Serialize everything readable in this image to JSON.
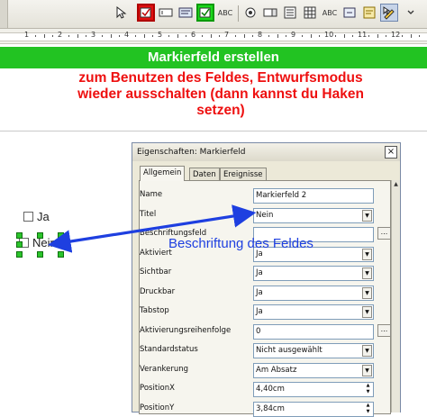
{
  "toolbar": {
    "buttons": [
      {
        "name": "checkbox-tool-button",
        "icon": "checkbox-icon",
        "state": "highlighted-red"
      },
      {
        "name": "textbox-tool-button",
        "icon": "text-field-icon",
        "state": "normal"
      },
      {
        "name": "label-tool-button",
        "icon": "label-icon",
        "state": "normal"
      },
      {
        "name": "checkbox-selected-button",
        "icon": "checkbox-checked-icon",
        "state": "highlighted-green"
      },
      {
        "name": "abc-button",
        "label": "ABC",
        "icon": "abc-icon",
        "state": "normal"
      },
      {
        "name": "radio-button-tool",
        "icon": "radio-icon",
        "state": "normal"
      },
      {
        "name": "grid-button",
        "icon": "grid-icon",
        "state": "normal"
      },
      {
        "name": "abc-button-2",
        "label": "ABC",
        "icon": "abc-icon",
        "state": "normal"
      },
      {
        "name": "form-button",
        "icon": "form-icon",
        "state": "normal"
      },
      {
        "name": "design-mode-button",
        "icon": "design-mode-icon",
        "state": "active"
      }
    ]
  },
  "ruler": {
    "numbers": [
      "1",
      "2",
      "3",
      "4",
      "5",
      "6",
      "7",
      "8",
      "9",
      "10",
      "11",
      "12"
    ]
  },
  "banner": {
    "text": "Markierfeld erstellen"
  },
  "instruction": {
    "line1": "zum Benutzen des Feldes, Entwurfsmodus",
    "line2": "wieder ausschalten (dann kannst du Haken",
    "line3": "setzen)"
  },
  "document": {
    "checkbox_ja": "Ja",
    "checkbox_nein": "Nein"
  },
  "annotation": {
    "label": "Beschriftung des Feldes"
  },
  "dialog": {
    "title": "Eigenschaften: Markierfeld",
    "close_glyph": "×",
    "tabs": [
      "Allgemein",
      "Daten",
      "Ereignisse"
    ],
    "selected_tab": "Allgemein",
    "properties": [
      {
        "label": "Name",
        "value": "Markierfeld 2",
        "control": "text"
      },
      {
        "label": "Titel",
        "value": "Nein",
        "control": "dropdown"
      },
      {
        "label": "Beschriftungsfeld",
        "value": "",
        "control": "ellipsis"
      },
      {
        "label": "Aktiviert",
        "value": "Ja",
        "control": "dropdown"
      },
      {
        "label": "Sichtbar",
        "value": "Ja",
        "control": "dropdown"
      },
      {
        "label": "Druckbar",
        "value": "Ja",
        "control": "dropdown"
      },
      {
        "label": "Tabstop",
        "value": "Ja",
        "control": "dropdown"
      },
      {
        "label": "Aktivierungsreihenfolge",
        "value": "0",
        "control": "ellipsis"
      },
      {
        "label": "Standardstatus",
        "value": "Nicht ausgewählt",
        "control": "dropdown"
      },
      {
        "label": "Verankerung",
        "value": "Am Absatz",
        "control": "dropdown"
      },
      {
        "label": "PositionX",
        "value": "4,40cm",
        "control": "spin"
      },
      {
        "label": "PositionY",
        "value": "3,84cm",
        "control": "spin"
      }
    ]
  },
  "colors": {
    "banner_bg": "#22c322",
    "instruction_text": "#ee1010",
    "annotation_blue": "#1e3fe0"
  }
}
